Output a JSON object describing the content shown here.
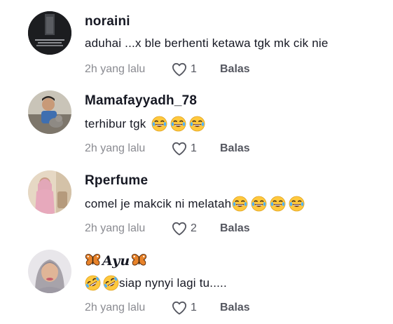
{
  "comments": [
    {
      "username": "noraini",
      "text": "aduhai ...x ble berhenti ketawa tgk mk cik nie",
      "time": "2h yang lalu",
      "likes": "1",
      "reply_label": "Balas"
    },
    {
      "username": "Mamafayyadh_78",
      "text": "terhibur tgk",
      "time": "2h yang lalu",
      "likes": "1",
      "reply_label": "Balas",
      "emojis": [
        "grinning-tears",
        "grinning-tears",
        "grinning-tears"
      ]
    },
    {
      "username": "Rperfume",
      "text": "comel je makcik ni melatah",
      "time": "2h yang lalu",
      "likes": "2",
      "reply_label": "Balas",
      "emojis": [
        "grinning-tears",
        "grinning-tears",
        "grinning-tears",
        "grinning-tears"
      ]
    },
    {
      "username": "Ayu",
      "username_decoration": "butterfly-emoji",
      "text": "siap nynyi lagi tu.....",
      "time": "2h yang lalu",
      "likes": "1",
      "reply_label": "Balas",
      "emojis": [
        "rolling-laughing",
        "rolling-laughing"
      ]
    }
  ],
  "colors": {
    "username": "#161823",
    "meta": "#8a8b91",
    "reply": "#555760",
    "emoji_face": "#ffc83d"
  }
}
